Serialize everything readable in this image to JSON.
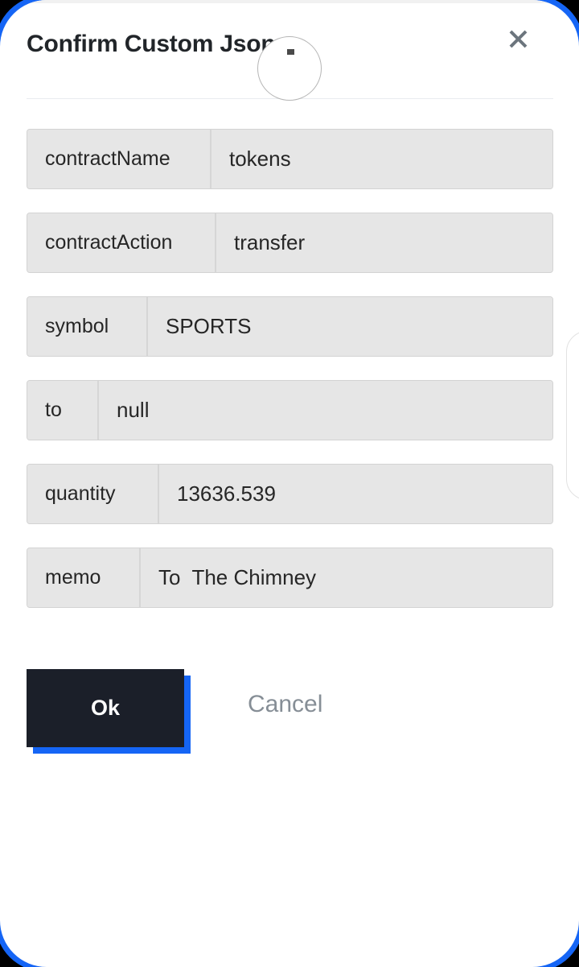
{
  "dialog": {
    "title": "Confirm Custom Json",
    "close_icon": "close-icon"
  },
  "fields": [
    {
      "label": "contractName",
      "value": "tokens",
      "label_width": 229
    },
    {
      "label": "contractAction",
      "value": "transfer",
      "label_width": 235
    },
    {
      "label": "symbol",
      "value": "SPORTS",
      "label_width": 150
    },
    {
      "label": "to",
      "value": "null",
      "label_width": 89
    },
    {
      "label": "quantity",
      "value": "13636.539",
      "label_width": 164
    },
    {
      "label": "memo",
      "value": "To  The Chimney",
      "label_width": 141
    }
  ],
  "footer": {
    "ok_label": "Ok",
    "cancel_label": "Cancel"
  },
  "colors": {
    "accent": "#1565f5",
    "ok_button_bg": "#1b1f29",
    "field_bg": "#e6e6e6",
    "field_border": "#d3d3d3",
    "cancel_text": "#868e96",
    "title_text": "#212529",
    "close_icon": "#6c757d",
    "frame": "#000000"
  },
  "overlay": {
    "touch_indicator": "touch-point-indicator"
  }
}
